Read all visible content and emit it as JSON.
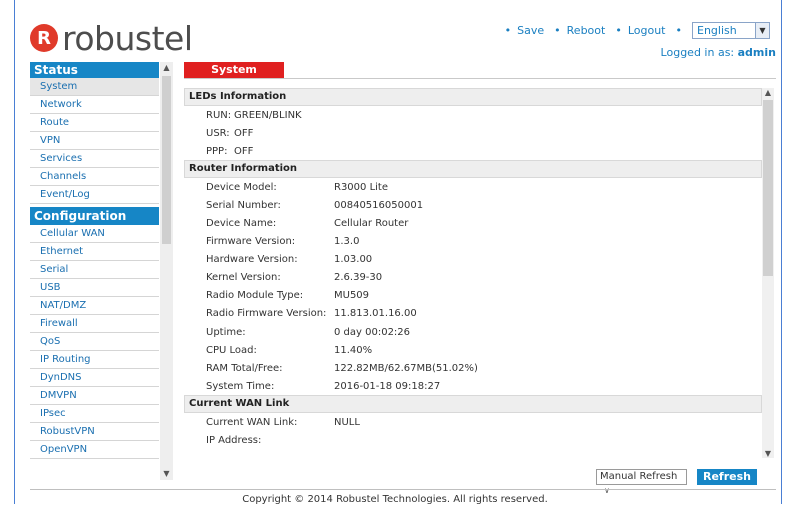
{
  "brand": {
    "logo_letter": "R",
    "logo_text": "robustel"
  },
  "topnav": {
    "save": "Save",
    "reboot": "Reboot",
    "logout": "Logout",
    "language": "English"
  },
  "user": {
    "logged_prefix": "Logged in as: ",
    "name": "admin"
  },
  "sidebar": {
    "status_title": "Status",
    "status_items": [
      "System",
      "Network",
      "Route",
      "VPN",
      "Services",
      "Channels",
      "Event/Log"
    ],
    "config_title": "Configuration",
    "config_items": [
      "Cellular WAN",
      "Ethernet",
      "Serial",
      "USB",
      "NAT/DMZ",
      "Firewall",
      "QoS",
      "IP Routing",
      "DynDNS",
      "DMVPN",
      "IPsec",
      "RobustVPN",
      "OpenVPN"
    ]
  },
  "tab": {
    "label": "System"
  },
  "sections": {
    "leds": {
      "title": "LEDs Information",
      "rows": [
        {
          "k": "RUN:",
          "v": "GREEN/BLINK"
        },
        {
          "k": "USR:",
          "v": "OFF"
        },
        {
          "k": "PPP:",
          "v": "OFF"
        }
      ]
    },
    "router": {
      "title": "Router Information",
      "rows": [
        {
          "k": "Device Model:",
          "v": "R3000 Lite"
        },
        {
          "k": "Serial Number:",
          "v": "00840516050001"
        },
        {
          "k": "Device Name:",
          "v": "Cellular Router"
        },
        {
          "k": "Firmware Version:",
          "v": "1.3.0"
        },
        {
          "k": "Hardware Version:",
          "v": "1.03.00"
        },
        {
          "k": "Kernel Version:",
          "v": "2.6.39-30"
        },
        {
          "k": "Radio Module Type:",
          "v": "MU509"
        },
        {
          "k": "Radio Firmware Version:",
          "v": "11.813.01.16.00"
        },
        {
          "k": "Uptime:",
          "v": "0 day 00:02:26"
        },
        {
          "k": "CPU Load:",
          "v": "11.40%"
        },
        {
          "k": "RAM Total/Free:",
          "v": "122.82MB/62.67MB(51.02%)"
        },
        {
          "k": "System Time:",
          "v": "2016-01-18 09:18:27"
        }
      ]
    },
    "wan": {
      "title": "Current WAN Link",
      "rows": [
        {
          "k": "Current WAN Link:",
          "v": "NULL"
        },
        {
          "k": "IP Address:",
          "v": ""
        }
      ]
    }
  },
  "bottom": {
    "refresh_mode": "Manual Refresh",
    "refresh_button": "Refresh"
  },
  "footer": {
    "copyright": "Copyright © 2014 Robustel Technologies. All rights reserved."
  }
}
